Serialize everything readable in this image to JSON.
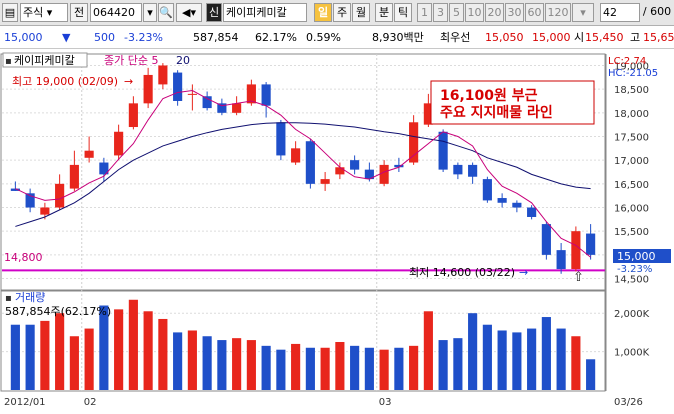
{
  "toolbar": {
    "market_select": "주식",
    "prev_label": "전",
    "code_value": "064420",
    "stock_badge": "신",
    "stock_name": "케이피케미칼",
    "period_selected": "일",
    "period_week": "주",
    "period_month": "월",
    "minute": "분",
    "tick": "틱",
    "intervals": [
      "1",
      "3",
      "5",
      "10",
      "20",
      "30",
      "60",
      "120"
    ],
    "count_value": "42",
    "count_total": "/ 600"
  },
  "ticker": {
    "price": "15,000",
    "change_arrow": "▼",
    "change": "500",
    "change_pct": "-3.23%",
    "volume": "587,854",
    "volume_pct": "62.17%",
    "turnover": "0.59%",
    "amount": "8,930백만",
    "best_ask_label": "최우선",
    "ask": "15,050",
    "bid": "15,000",
    "open_label": "시",
    "open": "15,450",
    "high_label": "고",
    "high": "15,65"
  },
  "chart_header": {
    "name": "케이피케미칼",
    "ma_label": "종가 단순 5",
    "ma2": "20",
    "lc": "LC:2.74",
    "hc": "HC:-21.05",
    "high_note": "최고 19,000 (02/09)",
    "low_note": "최저 14,600 (03/22)",
    "support_line_label": "14,800",
    "price_badge": "15,000",
    "price_badge_pct": "-3.23%",
    "annotation_line1": "16,100원 부근",
    "annotation_line2": "주요 지지매물 라인",
    "volume_label": "거래량",
    "volume_value": "587,854주(62.17%)",
    "x_labels": [
      "2012/01",
      "02",
      "03",
      "03/26"
    ]
  },
  "colors": {
    "up": "#e8261c",
    "down": "#1f4fc9",
    "ma5": "#c8007a",
    "ma20": "#101070",
    "support": "#d000c8"
  },
  "chart_data": {
    "type": "candlestick",
    "y_ticks": [
      14500,
      15000,
      15500,
      16000,
      16500,
      17000,
      17500,
      18000,
      18500,
      19000
    ],
    "y_tick_labels": [
      "14,500",
      "15,000",
      "15,500",
      "16,000",
      "16,500",
      "17,000",
      "17,500",
      "18,000",
      "18,500",
      "19,000"
    ],
    "ylim": [
      14300,
      19200
    ],
    "support": 14800,
    "candles": [
      {
        "o": 16400,
        "c": 16350,
        "h": 16550,
        "l": 16350
      },
      {
        "o": 16300,
        "c": 16000,
        "h": 16400,
        "l": 15900
      },
      {
        "o": 15850,
        "c": 16000,
        "h": 16100,
        "l": 15750
      },
      {
        "o": 16000,
        "c": 16500,
        "h": 16700,
        "l": 15950
      },
      {
        "o": 16400,
        "c": 16900,
        "h": 17200,
        "l": 16350
      },
      {
        "o": 17050,
        "c": 17200,
        "h": 17500,
        "l": 16950
      },
      {
        "o": 16950,
        "c": 16700,
        "h": 17050,
        "l": 16550
      },
      {
        "o": 17100,
        "c": 17600,
        "h": 17750,
        "l": 17000
      },
      {
        "o": 17700,
        "c": 18200,
        "h": 18350,
        "l": 17650
      },
      {
        "o": 18200,
        "c": 18800,
        "h": 18950,
        "l": 18100
      },
      {
        "o": 18600,
        "c": 19000,
        "h": 19050,
        "l": 18500
      },
      {
        "o": 18850,
        "c": 18250,
        "h": 18900,
        "l": 18150
      },
      {
        "o": 18400,
        "c": 18400,
        "h": 18600,
        "l": 18050
      },
      {
        "o": 18350,
        "c": 18100,
        "h": 18450,
        "l": 18050
      },
      {
        "o": 18200,
        "c": 18000,
        "h": 18300,
        "l": 17950
      },
      {
        "o": 18000,
        "c": 18200,
        "h": 18350,
        "l": 17950
      },
      {
        "o": 18200,
        "c": 18600,
        "h": 18700,
        "l": 18150
      },
      {
        "o": 18600,
        "c": 18150,
        "h": 18650,
        "l": 17900
      },
      {
        "o": 17800,
        "c": 17100,
        "h": 17850,
        "l": 17000
      },
      {
        "o": 16950,
        "c": 17250,
        "h": 17400,
        "l": 16900
      },
      {
        "o": 17400,
        "c": 16500,
        "h": 17450,
        "l": 16400
      },
      {
        "o": 16500,
        "c": 16600,
        "h": 16750,
        "l": 16350
      },
      {
        "o": 16700,
        "c": 16850,
        "h": 16950,
        "l": 16600
      },
      {
        "o": 17000,
        "c": 16800,
        "h": 17100,
        "l": 16700
      },
      {
        "o": 16800,
        "c": 16600,
        "h": 16950,
        "l": 16550
      },
      {
        "o": 16500,
        "c": 16900,
        "h": 17000,
        "l": 16450
      },
      {
        "o": 16900,
        "c": 16850,
        "h": 17050,
        "l": 16750
      },
      {
        "o": 16950,
        "c": 17800,
        "h": 17950,
        "l": 16900
      },
      {
        "o": 17750,
        "c": 18200,
        "h": 18400,
        "l": 17700
      },
      {
        "o": 17600,
        "c": 16800,
        "h": 17650,
        "l": 16750
      },
      {
        "o": 16900,
        "c": 16700,
        "h": 16950,
        "l": 16600
      },
      {
        "o": 16900,
        "c": 16650,
        "h": 16950,
        "l": 16500
      },
      {
        "o": 16600,
        "c": 16150,
        "h": 16650,
        "l": 16100
      },
      {
        "o": 16200,
        "c": 16100,
        "h": 16300,
        "l": 16000
      },
      {
        "o": 16100,
        "c": 16000,
        "h": 16150,
        "l": 15900
      },
      {
        "o": 16000,
        "c": 15800,
        "h": 16050,
        "l": 15750
      },
      {
        "o": 15650,
        "c": 15000,
        "h": 15700,
        "l": 14900
      },
      {
        "o": 15100,
        "c": 14700,
        "h": 15250,
        "l": 14600
      },
      {
        "o": 14700,
        "c": 15500,
        "h": 15600,
        "l": 14650
      },
      {
        "o": 15450,
        "c": 15000,
        "h": 15650,
        "l": 14900
      }
    ],
    "ma5": [
      16400,
      16250,
      16150,
      16180,
      16330,
      16520,
      16660,
      17020,
      17350,
      17850,
      18300,
      18430,
      18470,
      18300,
      18150,
      18200,
      18250,
      18150,
      17950,
      17650,
      17450,
      17150,
      16850,
      16650,
      16600,
      16750,
      16850,
      17100,
      17350,
      17600,
      17500,
      17300,
      16800,
      16450,
      16300,
      16100,
      15700,
      15350,
      15200,
      14950
    ],
    "ma20": [
      15600,
      15700,
      15800,
      15950,
      16100,
      16300,
      16550,
      16800,
      17000,
      17150,
      17300,
      17400,
      17500,
      17580,
      17650,
      17700,
      17750,
      17780,
      17790,
      17790,
      17780,
      17760,
      17730,
      17700,
      17650,
      17600,
      17560,
      17500,
      17450,
      17400,
      17300,
      17200,
      17050,
      16950,
      16850,
      16700,
      16600,
      16500,
      16430,
      16400
    ],
    "volume_ylim": [
      0,
      2500
    ],
    "volume_ticks": [
      1000,
      2000
    ],
    "volume_tick_labels": [
      "1,000K",
      "2,000K"
    ],
    "volume": [
      1700,
      1700,
      1800,
      2000,
      1400,
      1600,
      2200,
      2100,
      2350,
      2050,
      1850,
      1500,
      1550,
      1400,
      1300,
      1350,
      1300,
      1150,
      1050,
      1200,
      1100,
      1100,
      1250,
      1150,
      1100,
      1050,
      1100,
      1150,
      2050,
      1300,
      1350,
      2000,
      1700,
      1550,
      1500,
      1600,
      1900,
      1600,
      1400,
      800
    ],
    "x_label_positions": [
      0,
      5,
      25,
      39
    ]
  }
}
